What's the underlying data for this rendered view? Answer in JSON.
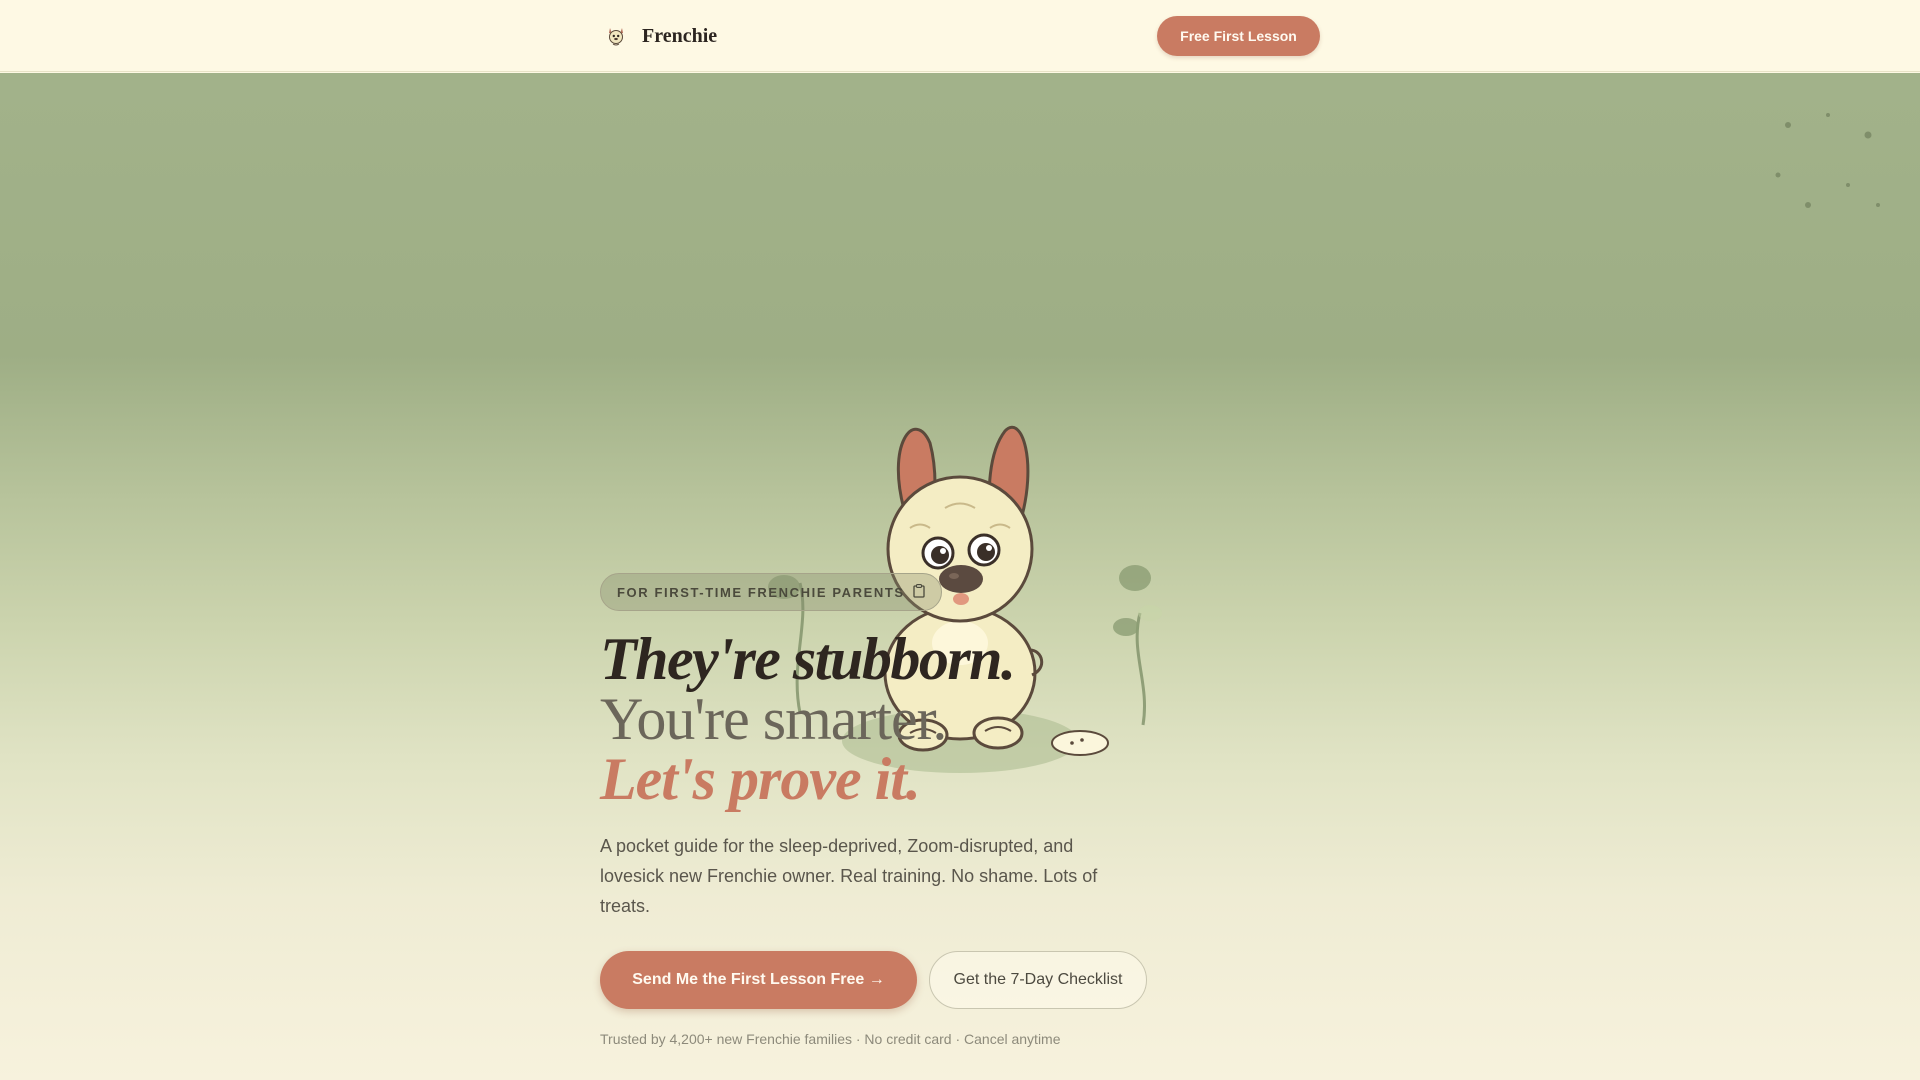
{
  "header": {
    "brand": "Frenchie",
    "cta_label": "Free First Lesson"
  },
  "hero": {
    "badge": "FOR FIRST-TIME FRENCHIE PARENTS",
    "headline_line1": "They're stubborn.",
    "headline_line2": "You're smarter.",
    "headline_line3": "Let's prove it.",
    "description": "A pocket guide for the sleep-deprived, Zoom-disrupted, and lovesick new Frenchie owner. Real training. No shame. Lots of treats.",
    "primary_cta": "Send Me the First Lesson Free →",
    "secondary_cta": "Get the 7-Day Checklist",
    "trust_line": "Trusted by 4,200+ new Frenchie families · No credit card · Cancel anytime"
  },
  "icons": {
    "logo": "dog-face-icon",
    "badge": "clipboard-icon"
  },
  "colors": {
    "accent": "#c97b62",
    "header_bg": "#fef9e4",
    "hero_top": "#a2b28a",
    "hero_bottom": "#f7f2dd",
    "text_dark": "#2e2620"
  }
}
